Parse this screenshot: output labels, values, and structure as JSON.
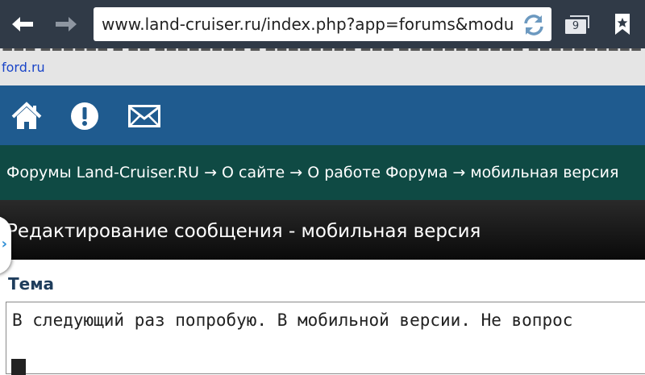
{
  "browser": {
    "url": "www.land-cruiser.ru/index.php?app=forums&module",
    "tab_count": "9"
  },
  "ad": {
    "link_text": "ford.ru"
  },
  "nav": {
    "icons": [
      "home-icon",
      "alert-icon",
      "mail-icon"
    ]
  },
  "breadcrumb": {
    "text": "Форумы Land-Cruiser.RU → О сайте → О работе Форума → мобильная версия"
  },
  "page": {
    "title": "Редактирование сообщения - мобильная версия"
  },
  "form": {
    "subject_label": "Тема",
    "message_text": "В следующий раз попробую. В мобильной версии. Не вопрос"
  },
  "colors": {
    "toolbar": "#303a47",
    "nav": "#1f5b8f",
    "breadcrumb": "#0f4a44",
    "heading": "#111111",
    "link": "#1a45c8"
  }
}
